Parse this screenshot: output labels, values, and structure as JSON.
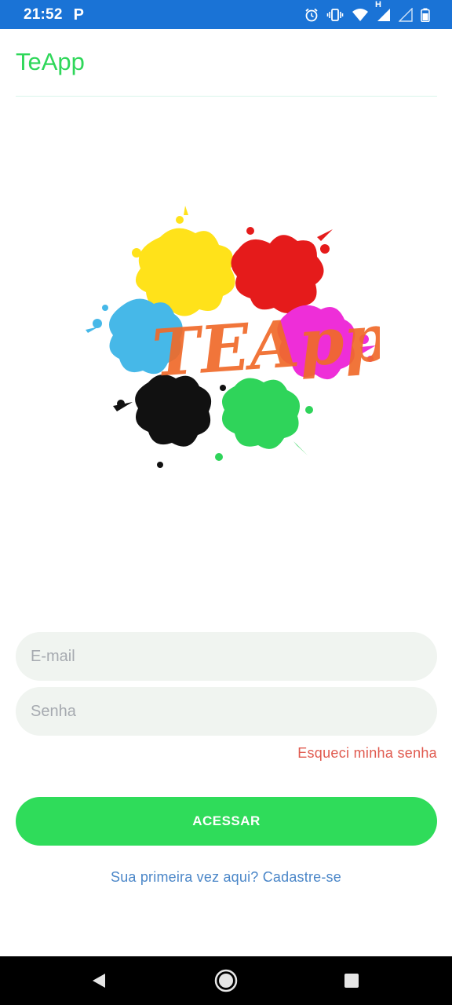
{
  "status_bar": {
    "time": "21:52",
    "app_indicator": "P",
    "network_label": "H",
    "icons": [
      "alarm-icon",
      "vibrate-icon",
      "wifi-icon",
      "signal-icon",
      "signal-empty-icon",
      "battery-icon"
    ],
    "background_color": "#1a73d6"
  },
  "app_bar": {
    "title": "TeApp",
    "title_color": "#2fd75a"
  },
  "logo": {
    "text": "TEApp",
    "splash_colors": [
      "#ffe21a",
      "#e51b1b",
      "#46b8e8",
      "#ee2ed8",
      "#111111",
      "#2fd45a"
    ],
    "text_color": "#f06a2a"
  },
  "login_form": {
    "email_placeholder": "E-mail",
    "email_value": "",
    "password_placeholder": "Senha",
    "password_value": "",
    "forgot_password": "Esqueci minha senha",
    "submit_label": "ACESSAR",
    "signup_prompt": "Sua primeira vez aqui? Cadastre-se"
  },
  "nav_bar": {
    "icons": [
      "back-icon",
      "home-icon",
      "recents-icon"
    ]
  }
}
